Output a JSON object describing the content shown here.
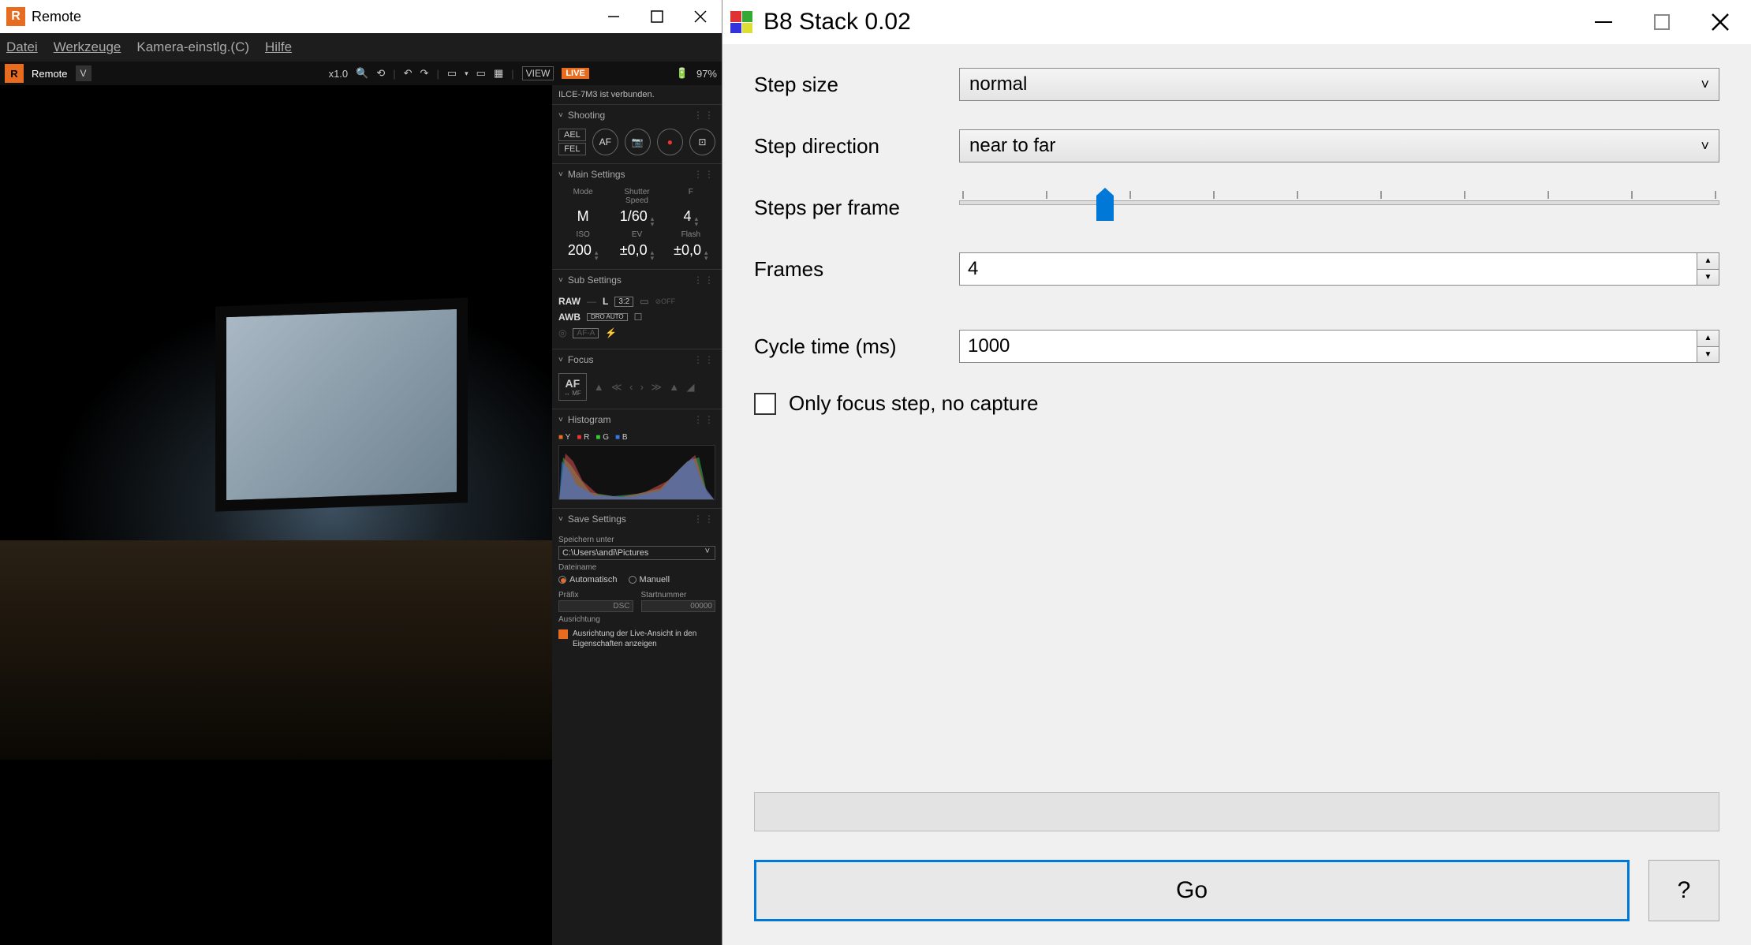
{
  "remote": {
    "title": "Remote",
    "menu": {
      "datei": "Datei",
      "werkzeuge": "Werkzeuge",
      "kamera": "Kamera-einstlg.(C)",
      "hilfe": "Hilfe"
    },
    "toolbar": {
      "tab": "Remote",
      "zoom": "x1.0",
      "view": "VIEW",
      "live": "LIVE",
      "battery": "97%"
    },
    "status": "ILCE-7M3 ist verbunden.",
    "sections": {
      "shooting": "Shooting",
      "main": "Main Settings",
      "sub": "Sub Settings",
      "focus": "Focus",
      "histogram": "Histogram",
      "save": "Save Settings"
    },
    "shoot": {
      "ael": "AEL",
      "fel": "FEL",
      "af": "AF"
    },
    "main": {
      "mode_lbl": "Mode",
      "mode": "M",
      "shutter_lbl": "Shutter Speed",
      "shutter": "1/60",
      "f_lbl": "F",
      "f": "4",
      "iso_lbl": "ISO",
      "iso": "200",
      "ev_lbl": "EV",
      "ev": "±0,0",
      "flash_lbl": "Flash",
      "flash": "±0,0"
    },
    "sub": {
      "raw": "RAW",
      "size": "L",
      "ratio": "3:2",
      "awb": "AWB",
      "dro": "DRO AUTO",
      "afa": "AF-A"
    },
    "focus": {
      "af": "AF",
      "mf": "↔ MF"
    },
    "hist": {
      "y": "Y",
      "r": "R",
      "g": "G",
      "b": "B"
    },
    "save": {
      "speichern": "Speichern unter",
      "path": "C:\\Users\\andi\\Pictures",
      "dateiname": "Dateiname",
      "auto": "Automatisch",
      "manuell": "Manuell",
      "prafix": "Präfix",
      "prafix_val": "DSC",
      "startnr": "Startnummer",
      "startnr_val": "00000",
      "ausrichtung": "Ausrichtung",
      "chk": "Ausrichtung der Live-Ansicht in den Eigenschaften anzeigen"
    }
  },
  "stack": {
    "title": "B8 Stack 0.02",
    "step_size_lbl": "Step size",
    "step_size": "normal",
    "step_dir_lbl": "Step direction",
    "step_dir": "near to far",
    "steps_per_frame_lbl": "Steps per frame",
    "frames_lbl": "Frames",
    "frames": "4",
    "cycle_lbl": "Cycle time (ms)",
    "cycle": "1000",
    "only_focus": "Only focus step, no capture",
    "go": "Go",
    "help": "?"
  }
}
